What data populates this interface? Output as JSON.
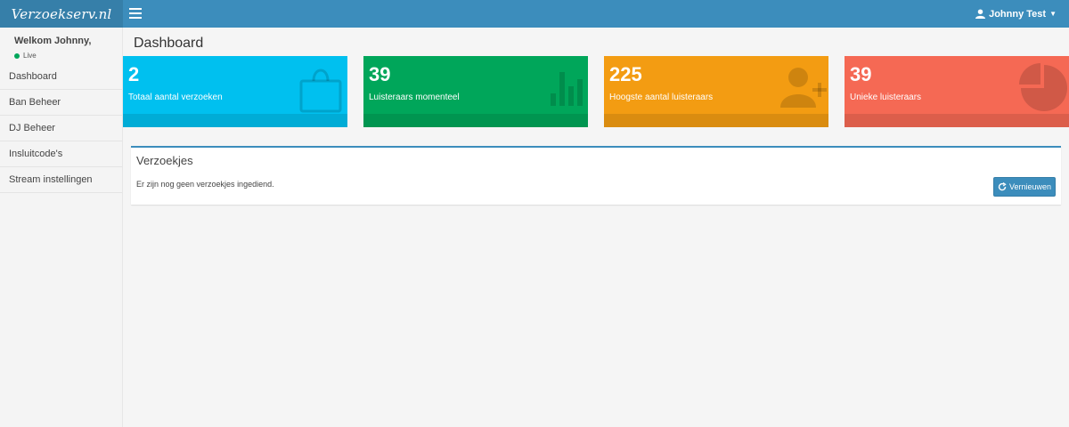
{
  "header": {
    "logo": "Verzoekserv.nl",
    "user_name": "Johnny Test"
  },
  "sidebar": {
    "welcome": "Welkom Johnny,",
    "status": "Live",
    "items": [
      {
        "label": "Dashboard"
      },
      {
        "label": "Ban Beheer"
      },
      {
        "label": "DJ Beheer"
      },
      {
        "label": "Insluitcode's"
      },
      {
        "label": "Stream instellingen"
      }
    ]
  },
  "main": {
    "title": "Dashboard",
    "stats": [
      {
        "value": "2",
        "label": "Totaal aantal verzoeken",
        "color": "#00c0ef",
        "icon": "shopping-bag-icon"
      },
      {
        "value": "39",
        "label": "Luisteraars momenteel",
        "color": "#00a65a",
        "icon": "bar-chart-icon"
      },
      {
        "value": "225",
        "label": "Hoogste aantal luisteraars",
        "color": "#f39c12",
        "icon": "user-add-icon"
      },
      {
        "value": "39",
        "label": "Unieke luisteraars",
        "color": "#f56954",
        "icon": "pie-chart-icon"
      }
    ],
    "panel": {
      "title": "Verzoekjes",
      "text": "Er zijn nog geen verzoekjes ingediend.",
      "button": "Vernieuwen"
    }
  },
  "colors": {
    "topbar": "#3c8dbc",
    "logo_bg": "#367fa9",
    "status_live": "#00a65a"
  }
}
